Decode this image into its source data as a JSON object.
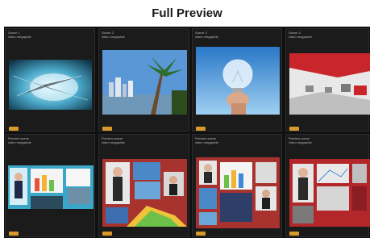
{
  "title": "Full Preview",
  "panels": [
    {
      "label": "Scene 1\nvideo megapixie"
    },
    {
      "label": "Scene 2\nvideo megapixie"
    },
    {
      "label": "Scene 3\nvideo megapixie"
    },
    {
      "label": "Scene 4\nvideo megapixie"
    },
    {
      "label": "Preview scene\nvideo megapixie"
    },
    {
      "label": "Preview scene\nvideo megapixie"
    },
    {
      "label": "Preview scene\nvideo megapixie"
    },
    {
      "label": "Preview scene\nvideo megapixie"
    }
  ],
  "colors": {
    "badge": "#d89a2a",
    "panel_bg": "#1b1b1b",
    "grid_bg": "#101010"
  }
}
